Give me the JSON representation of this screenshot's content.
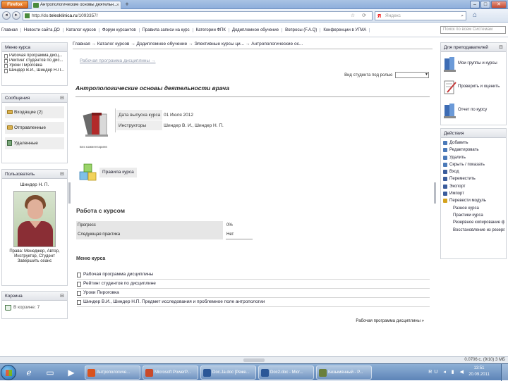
{
  "browser": {
    "menu_label": "Firefox",
    "tab_title": "Антропологические основы деятельн...",
    "new_tab": "+",
    "url_prefix": "http://do.",
    "url_domain": "telesklinica.ru",
    "url_path": "/1093357/",
    "search_placeholder": "Яндекс",
    "search_logo": "Я",
    "window_buttons": [
      "–",
      "□",
      "✕"
    ]
  },
  "bookmarks": [
    "Главная",
    "Новости сайта ДО",
    "Каталог курсов",
    "Форум курсантов",
    "Правила записи на курс",
    "Категории ФПК",
    "Додипломное обучение",
    "Вопросы (F.A.Q)",
    "Конференции в УГМА"
  ],
  "site_search_placeholder": "Поиск по всем Системам",
  "left": {
    "course_menu": {
      "title": "Меню курса",
      "items": [
        "Рабочая программа дисц...",
        "Рейтинг студентов по дис...",
        "Уроки Пироговка",
        "Шиндер В.И., Шиндер Н.П..."
      ]
    },
    "messages": {
      "title": "Сообщения",
      "items": [
        "Входящие (2)",
        "Отправленные",
        "Удаленные"
      ]
    },
    "user": {
      "title": "Пользователь",
      "name": "Шиндер Н. П.",
      "roles": "Права: Менеджер, Автор, Инструктор, Студент",
      "roles2": "Завершить сеанс"
    },
    "basket": {
      "title": "Корзина",
      "item": "В корзине: 7"
    }
  },
  "center": {
    "breadcrumb": "Главная → Каталог курсов → Додипломное обучение → Элективные курсы ци... → Антропологические ос...",
    "work_program_top": "Рабочая программа дисциплины →",
    "student_view_label": "Вид студента под ролью",
    "course_title": "Антропологические основы деятельности врача",
    "no_comments": "Без комментариев",
    "info": [
      {
        "key": "Дата выпуска курса",
        "value": "01 Июля 2012"
      },
      {
        "key": "Инструкторы",
        "value": "Шиндер В. И., Шиндер Н. П."
      }
    ],
    "rules_button": "Правила курса",
    "work_heading": "Работа с курсом",
    "work_rows": [
      {
        "key": "Прогресс",
        "value": "0%"
      },
      {
        "key": "Следующая практика",
        "value": "Нет"
      }
    ],
    "menu_heading": "Меню курса",
    "menu_items": [
      "Рабочая программа дисциплины",
      "Рейтинг студентов по дисциплине",
      "Уроки Пироговка",
      "Шиндер В.И., Шиндер Н.П. Предмет исследования и проблемное поле антропологии"
    ],
    "work_program_link": "Рабочая программа дисциплины »"
  },
  "right": {
    "teachers": {
      "title": "Для преподавателей",
      "items": [
        "Мои группы и курсы",
        "Проверить и оценить",
        "Отчет по курсу"
      ]
    },
    "actions": {
      "title": "Действия",
      "items": [
        {
          "label": "Добавить",
          "sub": false,
          "color": "#4a79b8"
        },
        {
          "label": "Редактировать",
          "sub": false,
          "color": "#4a79b8"
        },
        {
          "label": "Удалить",
          "sub": false,
          "color": "#4a79b8"
        },
        {
          "label": "Скрыть / показать",
          "sub": false,
          "color": "#4a79b8"
        },
        {
          "label": "Вход",
          "sub": false,
          "color": "#3a5c9c"
        },
        {
          "label": "Переместить",
          "sub": false,
          "color": "#3a5c9c"
        },
        {
          "label": "Экспорт",
          "sub": false,
          "color": "#3a5c9c"
        },
        {
          "label": "Импорт",
          "sub": false,
          "color": "#3a5c9c"
        },
        {
          "label": "Перевести модуль",
          "sub": false,
          "color": "#d4a21d"
        },
        {
          "label": "Разное курса",
          "sub": true,
          "color": ""
        },
        {
          "label": "Практики курса",
          "sub": true,
          "color": ""
        },
        {
          "label": "Резервное копирование файлов",
          "sub": true,
          "color": ""
        },
        {
          "label": "Восстановление из резервной копии",
          "sub": true,
          "color": ""
        }
      ]
    }
  },
  "status": {
    "text": "0.0706 с. (9/10) 3 МБ"
  },
  "taskbar": {
    "tasks": [
      {
        "label": "Антропологиче...",
        "color": "#d9531e"
      },
      {
        "label": "Microsoft PowerP...",
        "color": "#c94a2a"
      },
      {
        "label": "Doc.Ja.doc [Реже...",
        "color": "#2b5797"
      },
      {
        "label": "Doc2.doc - Micr...",
        "color": "#2b5797"
      },
      {
        "label": "Безымянный - P...",
        "color": "#6a7f3c"
      }
    ],
    "tray": "RU ◂ ▮ ◀",
    "time": "13:51",
    "date": "20.09.2011"
  }
}
